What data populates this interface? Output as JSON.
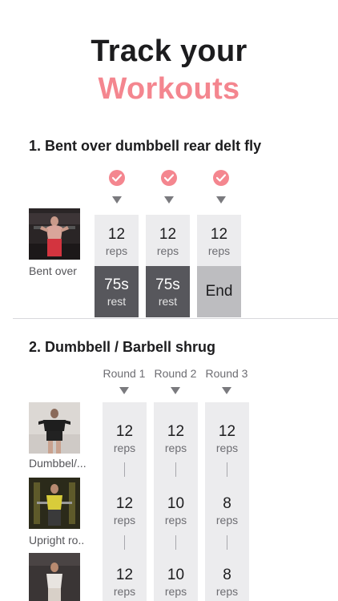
{
  "hero": {
    "line1": "Track your",
    "line2": "Workouts"
  },
  "colors": {
    "accent": "#f4868f",
    "dark_cell": "#57575c",
    "light_cell": "#ececee",
    "end_cell": "#bdbdc0"
  },
  "exercise1": {
    "title": "1. Bent over dumbbell rear delt fly",
    "thumb_caption": "Bent over",
    "sets": [
      {
        "reps": "12",
        "reps_unit": "reps",
        "rest": "75s",
        "rest_unit": "rest",
        "done": true
      },
      {
        "reps": "12",
        "reps_unit": "reps",
        "rest": "75s",
        "rest_unit": "rest",
        "done": true
      },
      {
        "reps": "12",
        "reps_unit": "reps",
        "end": "End",
        "done": true
      }
    ]
  },
  "exercise2": {
    "title": "2. Dumbbell / Barbell shrug",
    "rounds": [
      "Round 1",
      "Round 2",
      "Round 3"
    ],
    "thumb_captions": [
      "Dumbbel/...",
      "Upright ro..",
      ""
    ],
    "grid": [
      [
        {
          "v": "12",
          "u": "reps"
        },
        {
          "v": "12",
          "u": "reps"
        },
        {
          "v": "12",
          "u": "reps"
        }
      ],
      [
        {
          "v": "12",
          "u": "reps"
        },
        {
          "v": "10",
          "u": "reps"
        },
        {
          "v": "8",
          "u": "reps"
        }
      ],
      [
        {
          "v": "12",
          "u": "reps"
        },
        {
          "v": "10",
          "u": "reps"
        },
        {
          "v": "8",
          "u": "reps"
        }
      ]
    ]
  },
  "icons": {
    "check": "check-circle-icon",
    "arrow": "triangle-down-icon"
  }
}
